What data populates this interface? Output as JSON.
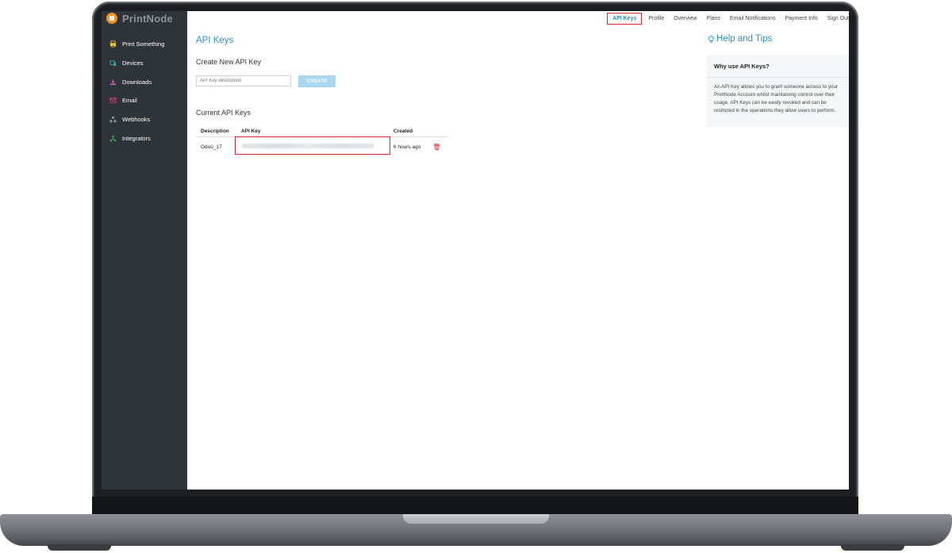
{
  "app": {
    "name": "PrintNode"
  },
  "sidebar": {
    "items": [
      {
        "label": "Print Something",
        "icon": "printer-icon",
        "color": "#f5c518"
      },
      {
        "label": "Devices",
        "icon": "devices-icon",
        "color": "#2bb5a5"
      },
      {
        "label": "Downloads",
        "icon": "download-icon",
        "color": "#c25ab3"
      },
      {
        "label": "Email",
        "icon": "email-icon",
        "color": "#e0437a"
      },
      {
        "label": "Webhooks",
        "icon": "webhooks-icon",
        "color": "#9aa0a6"
      },
      {
        "label": "Integrators",
        "icon": "integrators-icon",
        "color": "#3cb65a"
      }
    ]
  },
  "topnav": {
    "items": [
      "API Keys",
      "Profile",
      "Overview",
      "Plans",
      "Email Notifications",
      "Payment Info",
      "Sign Out"
    ],
    "active": "API Keys"
  },
  "main": {
    "title": "API Keys",
    "create": {
      "heading": "Create New API Key",
      "placeholder": "API Key description",
      "button": "CREATE"
    },
    "current": {
      "heading": "Current API Keys",
      "columns": [
        "Description",
        "API Key",
        "Created"
      ],
      "rows": [
        {
          "description": "Odoo_17",
          "created": "6 hours ago"
        }
      ]
    }
  },
  "help": {
    "title": "Help and Tips",
    "question": "Why use API Keys?",
    "body": "An API Key allows you to grant someone access to your PrintNode Account whilst maintaining control over their usage. API Keys can be easily revoked and can be restricted in the operations they allow users to perform."
  },
  "colors": {
    "accent": "#2a92d2",
    "highlight": "#e0242b",
    "sidebar": "#2f3439"
  }
}
